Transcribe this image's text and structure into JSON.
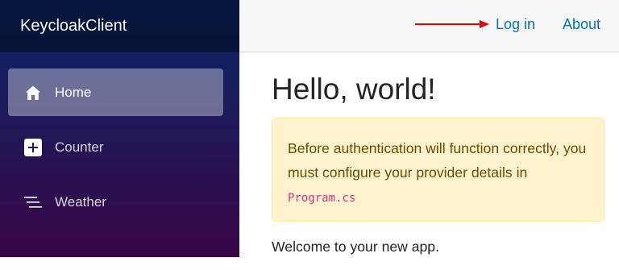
{
  "brand": {
    "title": "KeycloakClient"
  },
  "nav": {
    "items": [
      {
        "label": "Home",
        "icon": "home-icon",
        "active": true
      },
      {
        "label": "Counter",
        "icon": "plus-square-icon",
        "active": false
      },
      {
        "label": "Weather",
        "icon": "list-icon",
        "active": false
      }
    ]
  },
  "top_row": {
    "login_label": "Log in",
    "about_label": "About",
    "annotation": "arrow pointing to Log in (red)"
  },
  "main": {
    "heading": "Hello, world!",
    "alert": {
      "text": "Before authentication will function correctly, you must configure your provider details in ",
      "code": "Program.cs"
    },
    "welcome": "Welcome to your new app."
  },
  "colors": {
    "sidebar_top": "#052767",
    "sidebar_bottom": "#3a0647",
    "link": "#0071c1",
    "alert_bg": "#fff3cd",
    "alert_text": "#664d03",
    "code": "#d63384",
    "annotation_arrow": "#e00000"
  }
}
